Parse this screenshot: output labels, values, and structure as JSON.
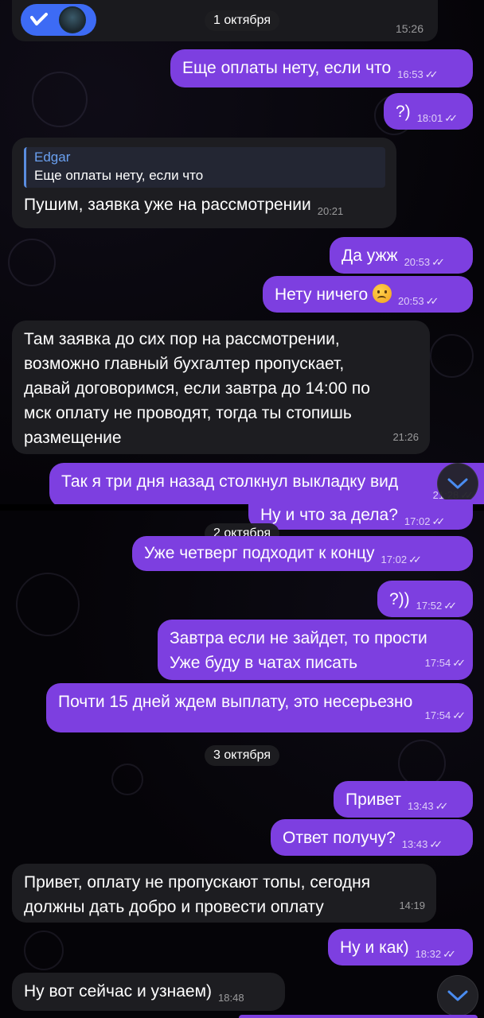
{
  "dates": {
    "d1": "1 октября",
    "d2": "2 октября",
    "d3": "3 октября"
  },
  "header_card": {
    "time": "15:26"
  },
  "messages": [
    {
      "text": "Еще оплаты нету, если что",
      "time": "16:53"
    },
    {
      "text": "?)",
      "time": "18:01"
    },
    {
      "reply_name": "Edgar",
      "reply_text": "Еще оплаты нету, если что",
      "text": "Пушим, заявка уже на рассмотрении",
      "time": "20:21"
    },
    {
      "text": "Да ужж",
      "time": "20:53"
    },
    {
      "text": "Нету ничего",
      "time": "20:53"
    },
    {
      "lines": [
        "Там заявка до сих пор на рассмотрении,",
        "возможно главный бухгалтер пропускает,",
        "давай договоримся, если завтра до 14:00 по",
        "мск оплату не проводят, тогда ты стопишь",
        "размещение"
      ],
      "time": "21:26"
    },
    {
      "text": "Так я три дня назад столкнул выкладку вид",
      "time": "21:28"
    },
    {
      "text": "Ну и что за дела?",
      "time": "17:02"
    },
    {
      "text": "Уже четверг подходит к концу",
      "time": "17:02"
    },
    {
      "text": "?))",
      "time": "17:52"
    },
    {
      "lines": [
        "Завтра если не зайдет, то прости",
        "Уже буду в чатах писать"
      ],
      "time": "17:54"
    },
    {
      "text": "Почти 15 дней ждем выплату, это несерьезно",
      "time": "17:54"
    },
    {
      "text": "Привет",
      "time": "13:43"
    },
    {
      "text": "Ответ получу?",
      "time": "13:43"
    },
    {
      "lines": [
        "Привет, оплату не пропускают топы, сегодня",
        "должны дать добро и провести оплату"
      ],
      "time": "14:19"
    },
    {
      "text": "Ну и как)",
      "time": "18:32"
    },
    {
      "text": "Ну вот сейчас и узнаем)",
      "time": "18:48"
    }
  ],
  "icons": {
    "read_check": "double-check-icon",
    "scroll_down": "chevron-down-icon",
    "emoji": "worried-face-icon"
  },
  "colors": {
    "outgoing": "#7d3fe0",
    "incoming": "#1d1d21",
    "reply_accent": "#6aa0f0"
  }
}
